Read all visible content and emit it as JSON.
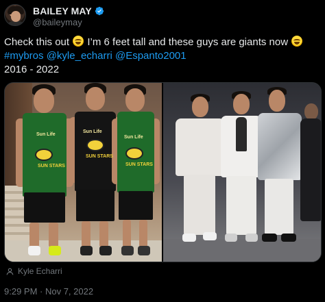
{
  "author": {
    "display_name": "BAILEY MAY",
    "handle": "@baileymay",
    "verified": true,
    "verified_color": "#1d9bf0"
  },
  "tweet": {
    "line1_before": "Check this out ",
    "line1_mid": " I’m 6 feet tall and these guys are giants now ",
    "emoji": "joy-emoji",
    "line2_hashtag": "#mybros",
    "line2_mention1": "@kyle_echarri",
    "line2_mention2": "@Espanto2001",
    "line3": "2016 - 2022"
  },
  "media": {
    "photos": [
      {
        "name": "left-photo",
        "jersey_brand": "Sun Life",
        "jersey_event": "SUN STARS"
      },
      {
        "name": "right-photo"
      }
    ],
    "tag": "Kyle Echarri"
  },
  "meta": {
    "timestamp": "9:29 PM · Nov 7, 2022"
  },
  "colors": {
    "background": "#000000",
    "text": "#e7e9ea",
    "secondary": "#71767b",
    "link": "#1d9bf0"
  }
}
